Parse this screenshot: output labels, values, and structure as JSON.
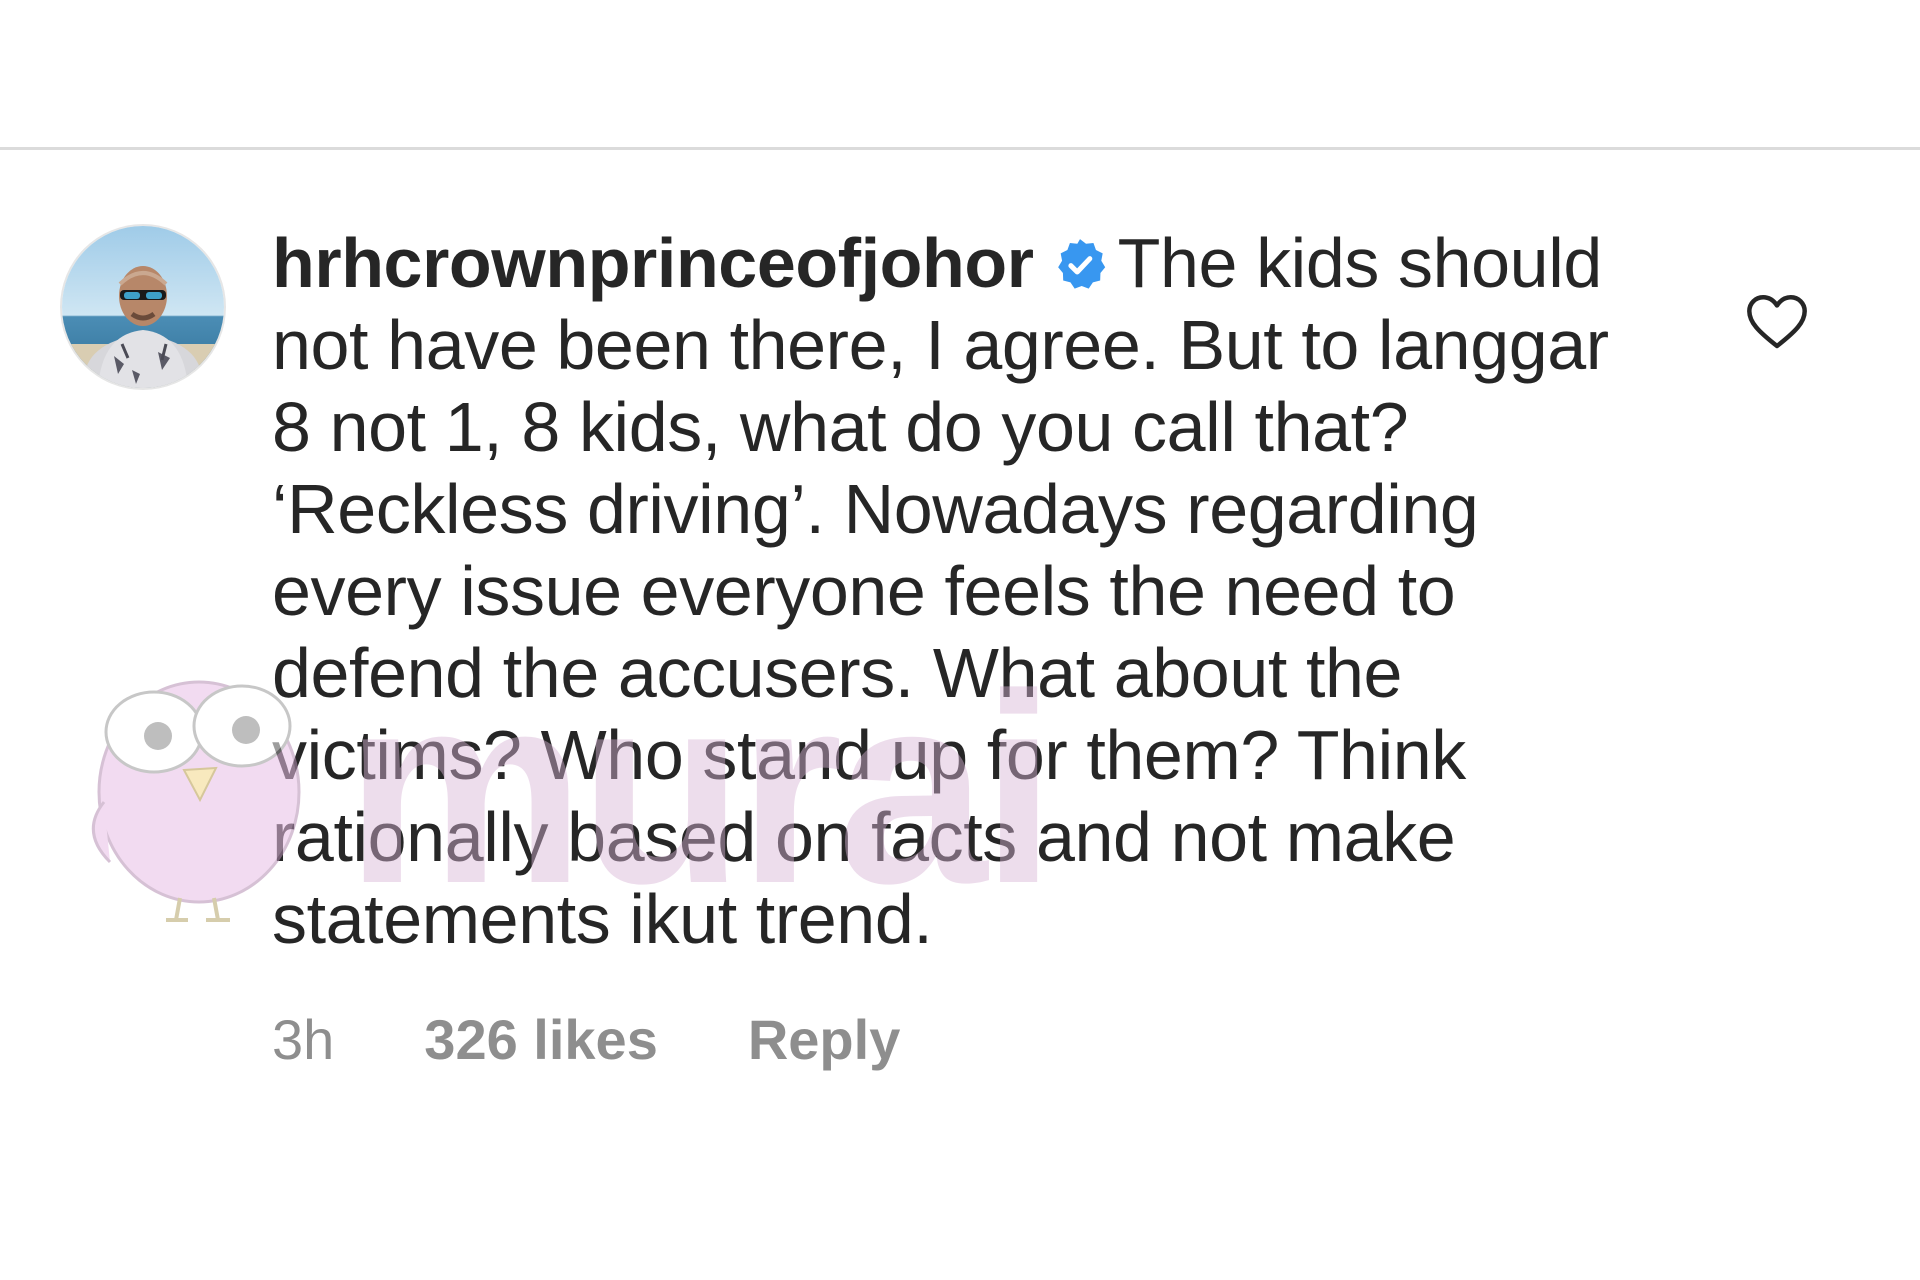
{
  "comment": {
    "username": "hrhcrownprinceofjohor",
    "text": "The kids should not have been there, I agree. But to langgar 8 not 1, 8 kids, what do you call that? ‘Reckless driving’. Nowadays regarding every issue everyone feels the need to defend the accusers. What about the victims? Who stand up for them? Think rationally based on facts and not make statements ikut trend.",
    "time": "3h",
    "likes": "326 likes",
    "reply_label": "Reply"
  },
  "icons": {
    "verified": "verified-badge-icon",
    "like": "heart-outline-icon",
    "avatar": "profile-avatar"
  },
  "watermark": {
    "text": "murai",
    "color": "#d8b4d6"
  },
  "colors": {
    "text": "#262626",
    "secondary": "#8e8e8e",
    "verified": "#3897f0",
    "divider": "#dbdbdb"
  }
}
